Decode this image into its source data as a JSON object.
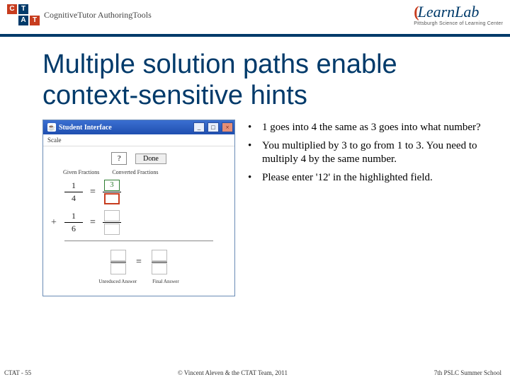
{
  "header": {
    "ctat_letters": [
      "C",
      "T",
      "A",
      "T"
    ],
    "cg_text": "CognitiveTutor AuthoringTools",
    "learnlab": "LearnLab",
    "learnlab_sub": "Pittsburgh Science of Learning Center"
  },
  "title": "Multiple solution paths enable context-sensitive hints",
  "si": {
    "caption": "Student Interface",
    "menu": "Scale",
    "q": "?",
    "done": "Done",
    "col1": "Given Fractions",
    "col2": "Converted Fractions",
    "f1": {
      "num": "1",
      "den": "4"
    },
    "f2": {
      "num": "1",
      "den": "6"
    },
    "conv_num": "3",
    "unreduced": "Unreduced Answer",
    "final": "Final Answer"
  },
  "bullets": [
    "1 goes into 4 the same as 3 goes into what number?",
    "You multiplied by 3 to go from 1 to 3. You need to multiply 4 by the same number.",
    "Please enter '12' in the highlighted field."
  ],
  "footer": {
    "left": "CTAT - 55",
    "center": "© Vincent Aleven & the CTAT Team, 2011",
    "right": "7th PSLC Summer School"
  }
}
